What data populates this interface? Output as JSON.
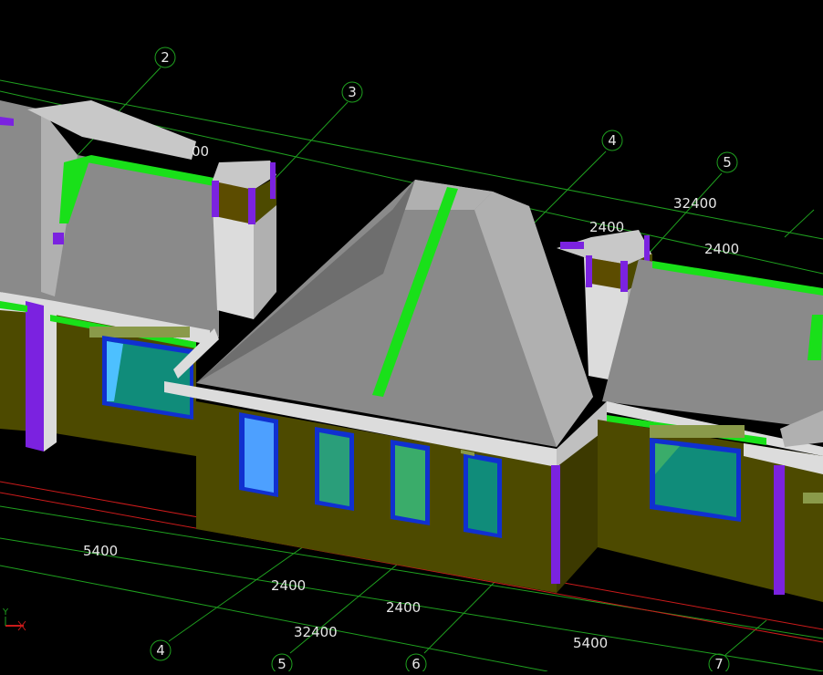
{
  "viewport": {
    "background": "#000000",
    "colors": {
      "wall": "#4d4a00",
      "wall_dark": "#3c3900",
      "roof": "#8a8a8a",
      "roof_light": "#b0b0b0",
      "roof_dark": "#6e6e6e",
      "trim": "#dcdcdc",
      "accent_green": "#19e019",
      "accent_purple": "#7b22e0",
      "glass": "#108c7a",
      "window_frame": "#1030d0",
      "grid_line": "#1fa01f",
      "axis_red": "#cc1b1b"
    }
  },
  "grid_bubbles": {
    "top": [
      "2",
      "3",
      "4",
      "5"
    ],
    "bottom": [
      "4",
      "5",
      "6",
      "7"
    ]
  },
  "dimensions": {
    "upper": [
      "00",
      "2400",
      "32400",
      "2400"
    ],
    "lower": [
      "5400",
      "2400",
      "2400",
      "32400",
      "5400"
    ]
  },
  "ucs_icon": {
    "label": "Y",
    "icon": "ucs-axis-icon"
  }
}
